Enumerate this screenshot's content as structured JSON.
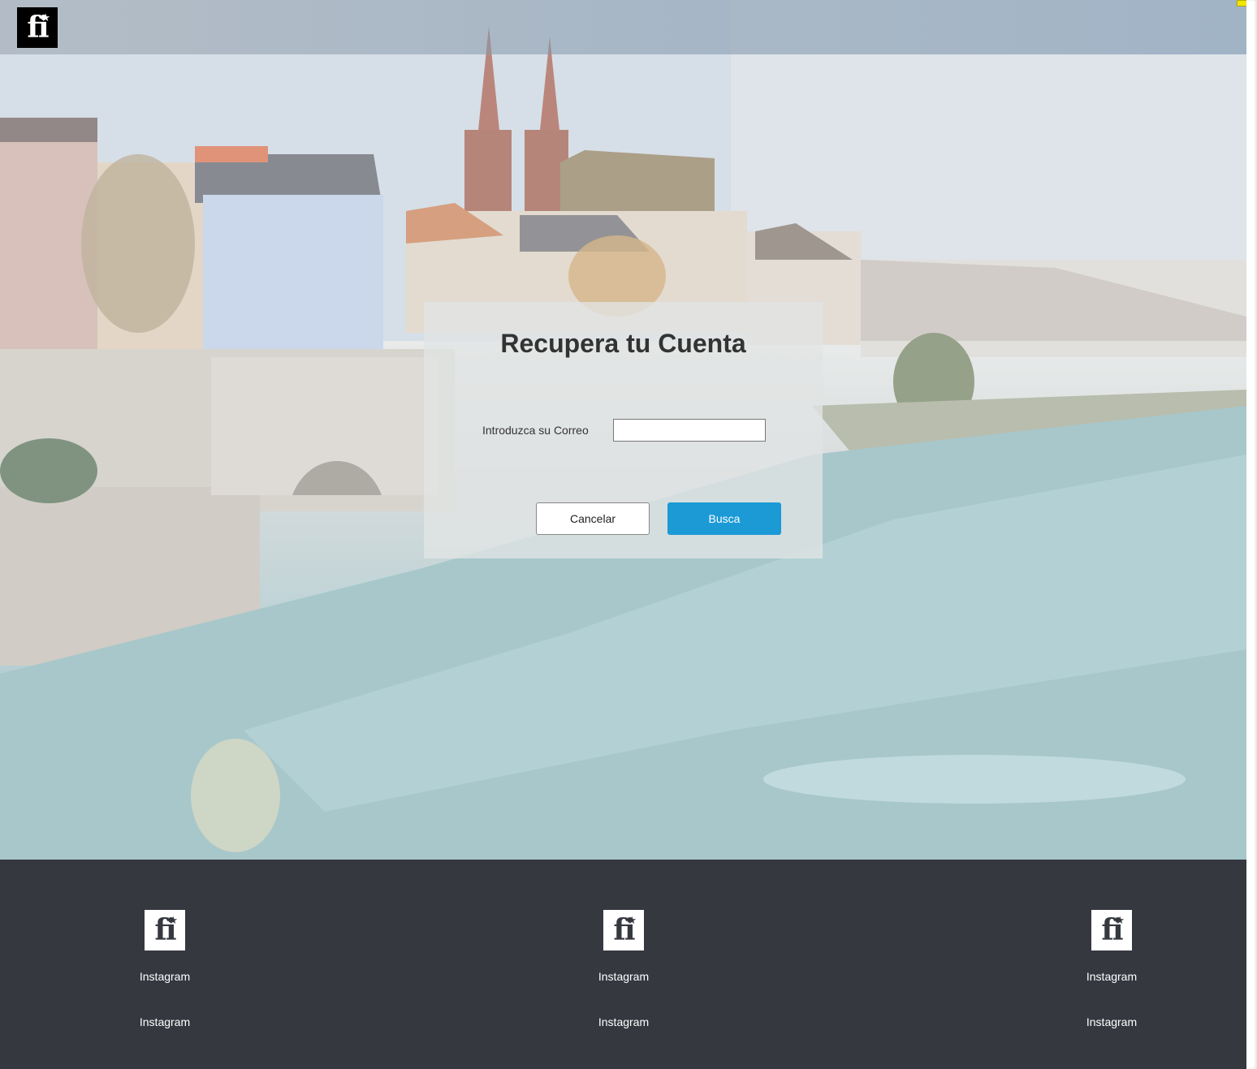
{
  "header": {
    "logo_text": "fi",
    "logo_star": "★"
  },
  "recover": {
    "title": "Recupera tu Cuenta",
    "email_label": "Introduzca su Correo",
    "email_value": "",
    "email_placeholder": "",
    "cancel_label": "Cancelar",
    "search_label": "Busca"
  },
  "footer": {
    "columns": [
      {
        "logo_text": "fi",
        "logo_star": "★",
        "links": [
          "Instagram",
          "Instagram"
        ]
      },
      {
        "logo_text": "fi",
        "logo_star": "★",
        "links": [
          "Instagram",
          "Instagram"
        ]
      },
      {
        "logo_text": "fi",
        "logo_star": "★",
        "links": [
          "Instagram",
          "Instagram"
        ]
      }
    ]
  },
  "colors": {
    "footer_bg": "#363840",
    "primary_button": "#1b9ad6",
    "logo_bg": "#000000"
  }
}
